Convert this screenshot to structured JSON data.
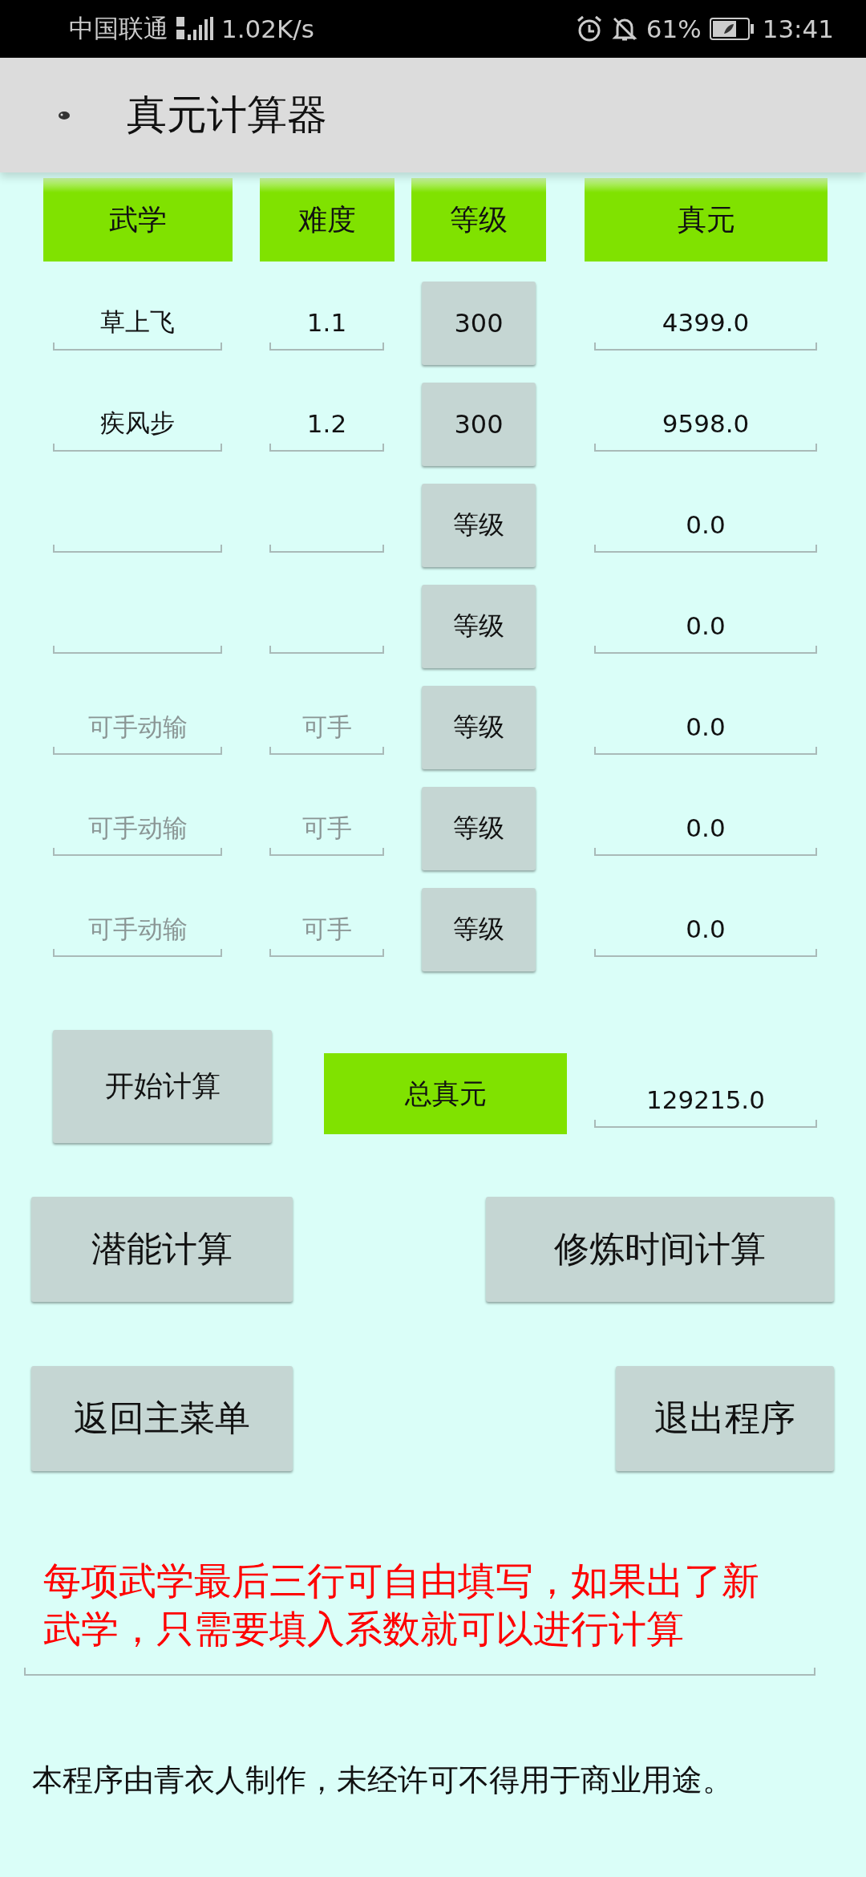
{
  "status_bar": {
    "carrier": "中国联通",
    "speed": "1.02K/s",
    "battery": "61%",
    "time": "13:41"
  },
  "app_bar": {
    "title": "真元计算器"
  },
  "headers": [
    "武学",
    "难度",
    "等级",
    "真元"
  ],
  "rows": [
    {
      "name": "草上飞",
      "difficulty": "1.1",
      "grade": "300",
      "value": "4399.0"
    },
    {
      "name": "疾风步",
      "difficulty": "1.2",
      "grade": "300",
      "value": "9598.0"
    },
    {
      "grade": "等级",
      "value": "0.0"
    },
    {
      "grade": "等级",
      "value": "0.0"
    },
    {
      "name_placeholder": "可手动输",
      "difficulty_placeholder": "可手",
      "grade": "等级",
      "value": "0.0"
    },
    {
      "name_placeholder": "可手动输",
      "difficulty_placeholder": "可手",
      "grade": "等级",
      "value": "0.0"
    },
    {
      "name_placeholder": "可手动输",
      "difficulty_placeholder": "可手",
      "grade": "等级",
      "value": "0.0"
    }
  ],
  "calculate_button": "开始计算",
  "total": {
    "label": "总真元",
    "value": "129215.0"
  },
  "nav_buttons": [
    [
      "潜能计算",
      "修炼时间计算"
    ],
    [
      "返回主菜单",
      "退出程序"
    ]
  ],
  "note": "每项武学最后三行可自由填写，如果出了新武学，只需要填入系数就可以进行计算",
  "footer": "本程序由青衣人制作，未经许可不得用于商业用途。"
}
